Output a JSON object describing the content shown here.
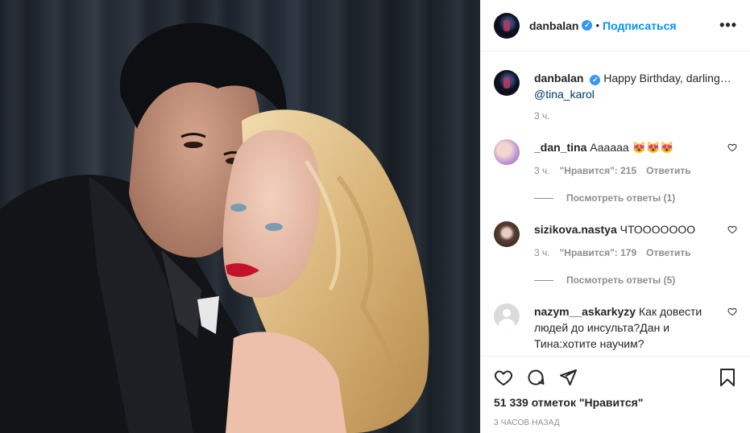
{
  "post": {
    "username": "danbalan",
    "follow_label": "Подписаться",
    "more_label": "•••",
    "caption_text": "Happy Birthday, darling…",
    "caption_mention": "@tina_karol",
    "caption_time": "3 ч."
  },
  "comments": [
    {
      "username": "_dan_tina",
      "text": "Аааааа 😻😻😻",
      "time": "3 ч.",
      "likes": "\"Нравится\": 215",
      "reply_label": "Ответить",
      "view_replies": "Посмотреть ответы (1)"
    },
    {
      "username": "sizikova.nastya",
      "text": "ЧТООООООО",
      "time": "3 ч.",
      "likes": "\"Нравится\": 179",
      "reply_label": "Ответить",
      "view_replies": "Посмотреть ответы (5)"
    },
    {
      "username": "nazym__askarkyzy",
      "text": "Как довести людей до инсульта?Дан и Тина:хотите научим?"
    }
  ],
  "footer": {
    "likes_count": "51 339 отметок \"Нравится\"",
    "timestamp": "3 ЧАСОВ НАЗАД"
  },
  "colors": {
    "accent": "#0095f6",
    "verified": "#3897f0",
    "muted": "#8e8e8e"
  },
  "icons": [
    "verified-badge-icon",
    "more-options-icon",
    "heart-icon",
    "comment-icon",
    "share-icon",
    "bookmark-icon"
  ]
}
